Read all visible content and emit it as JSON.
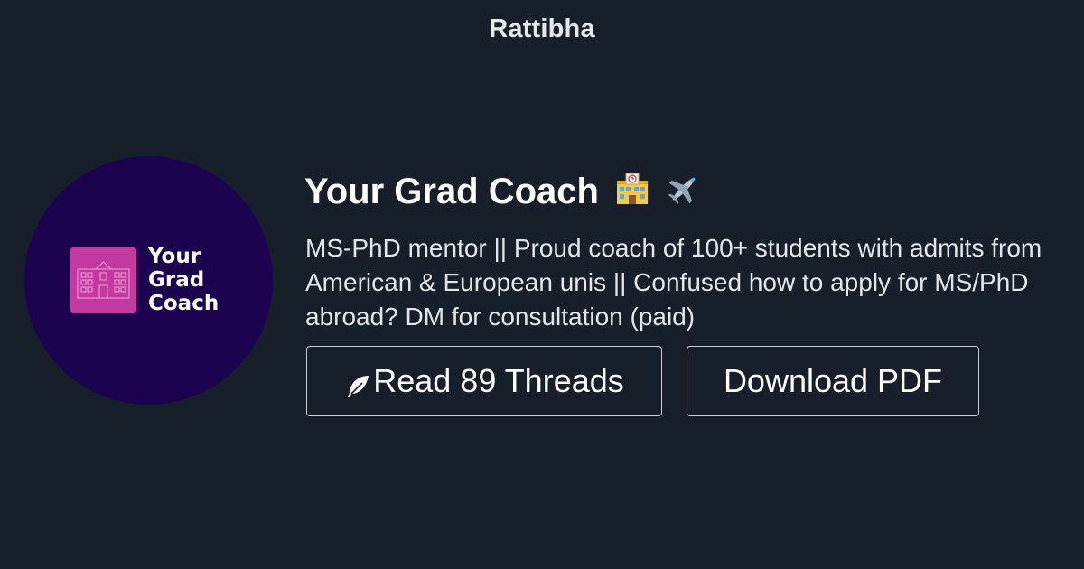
{
  "site": {
    "name": "Rattibha"
  },
  "profile": {
    "name": "Your Grad Coach",
    "name_emojis": [
      "school-icon",
      "airplane-icon"
    ],
    "bio": "MS-PhD mentor || Proud coach of 100+ students with admits from American & European unis || Confused how to apply for MS/PhD abroad? DM for consultation (paid)",
    "avatar": {
      "logo_lines": [
        "Your",
        "Grad",
        "Coach"
      ],
      "background_color": "#1c0350",
      "badge_color": "#c23aa0"
    }
  },
  "actions": {
    "read_threads_label": "Read 89 Threads",
    "read_threads_icon": "feather-icon",
    "download_pdf_label": "Download PDF"
  },
  "colors": {
    "background": "#17202a",
    "text": "#ffffff",
    "button_border": "#c9ccd0"
  }
}
